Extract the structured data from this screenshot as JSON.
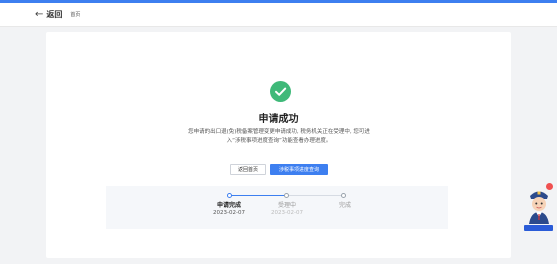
{
  "header": {
    "back_label": "返回",
    "breadcrumb": "首页"
  },
  "result": {
    "title": "申请成功",
    "description": "您申请的出口退(免)税备案管理变更申请成功, 税务机关正在受理中, 您可进入“涉税事项进度查询”功能查看办理进度。"
  },
  "actions": {
    "home_label": "返回首页",
    "query_label": "涉税事项进度查询"
  },
  "steps": [
    {
      "label": "申请完成",
      "date": "2023-02-07",
      "status": "done"
    },
    {
      "label": "受理中",
      "date": "2023-02-07",
      "status": "pending"
    },
    {
      "label": "完成",
      "date": "",
      "status": "pending"
    }
  ],
  "assistant": {
    "badge_label": "",
    "notification_count": ""
  },
  "colors": {
    "accent": "#3d7ff0",
    "success": "#3fb979",
    "background": "#f2f3f5"
  }
}
